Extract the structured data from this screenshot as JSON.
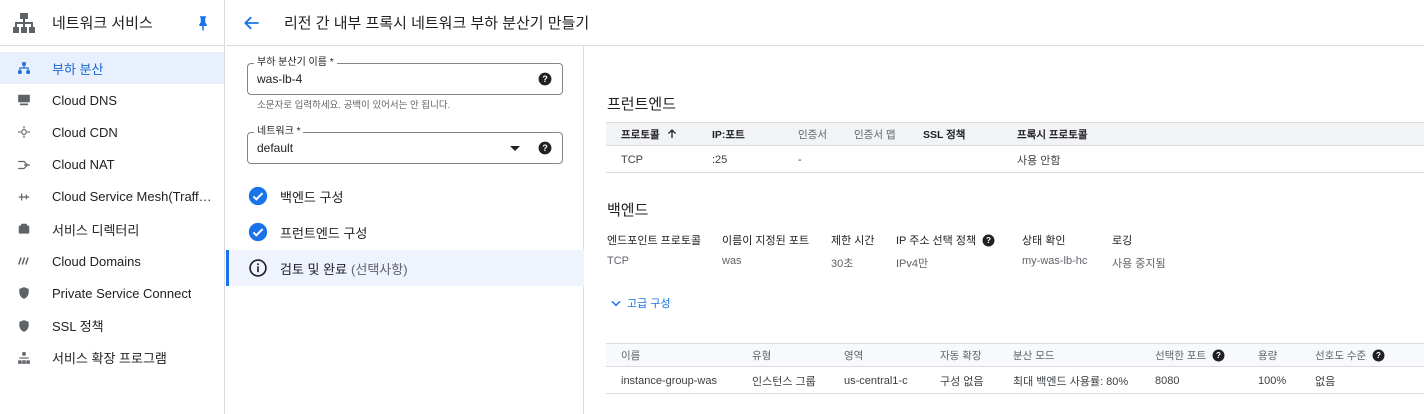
{
  "sidebar": {
    "title": "네트워크 서비스",
    "items": [
      {
        "label": "부하 분산",
        "icon": "load-balancing-icon",
        "active": true
      },
      {
        "label": "Cloud DNS",
        "icon": "dns-icon"
      },
      {
        "label": "Cloud CDN",
        "icon": "cdn-icon"
      },
      {
        "label": "Cloud NAT",
        "icon": "nat-icon"
      },
      {
        "label": "Cloud Service Mesh(Traffi...",
        "icon": "service-mesh-icon"
      },
      {
        "label": "서비스 디렉터리",
        "icon": "service-directory-icon"
      },
      {
        "label": "Cloud Domains",
        "icon": "domains-icon"
      },
      {
        "label": "Private Service Connect",
        "icon": "private-service-connect-icon"
      },
      {
        "label": "SSL 정책",
        "icon": "ssl-policy-icon"
      },
      {
        "label": "서비스 확장 프로그램",
        "icon": "service-extensions-icon"
      }
    ]
  },
  "header": {
    "title": "리전 간 내부 프록시 네트워크 부하 분산기 만들기"
  },
  "form": {
    "name_label": "부하 분산기 이름 *",
    "name_value": "was-lb-4",
    "name_hint": "소문자로 입력하세요. 공백이 있어서는 안 됩니다.",
    "network_label": "네트워크 *",
    "network_value": "default",
    "steps": [
      {
        "label": "백엔드 구성",
        "state": "done"
      },
      {
        "label": "프런트엔드 구성",
        "state": "done"
      },
      {
        "label": "검토 및 완료",
        "sub": "(선택사항)",
        "state": "current"
      }
    ]
  },
  "frontend": {
    "title": "프런트엔드",
    "headers": [
      "프로토콜",
      "IP:포트",
      "인증서",
      "인증서 맵",
      "SSL 정책",
      "프록시 프로토콜"
    ],
    "row": [
      "TCP",
      ":25",
      "-",
      "",
      "",
      "사용 안함"
    ]
  },
  "backend": {
    "title": "백엔드",
    "labels": [
      "엔드포인트 프로토콜",
      "이름이 지정된 포트",
      "제한 시간",
      "IP 주소 선택 정책",
      "상태 확인",
      "로깅"
    ],
    "values": [
      "TCP",
      "was",
      "30초",
      "IPv4만",
      "my-was-lb-hc",
      "사용 중지됨"
    ],
    "advanced_label": "고급 구성",
    "table_headers": [
      "이름",
      "유형",
      "영역",
      "자동 확장",
      "분산 모드",
      "선택한 포트",
      "용량",
      "선호도 수준"
    ],
    "table_row": [
      "instance-group-was",
      "인스턴스 그룹",
      "us-central1-c",
      "구성 없음",
      "최대 백엔드 사용률: 80%",
      "8080",
      "100%",
      "없음"
    ]
  },
  "colors": {
    "accent": "#1a73e8",
    "active_bg": "#e8f0fe",
    "header_bg": "#f1f3f4"
  }
}
